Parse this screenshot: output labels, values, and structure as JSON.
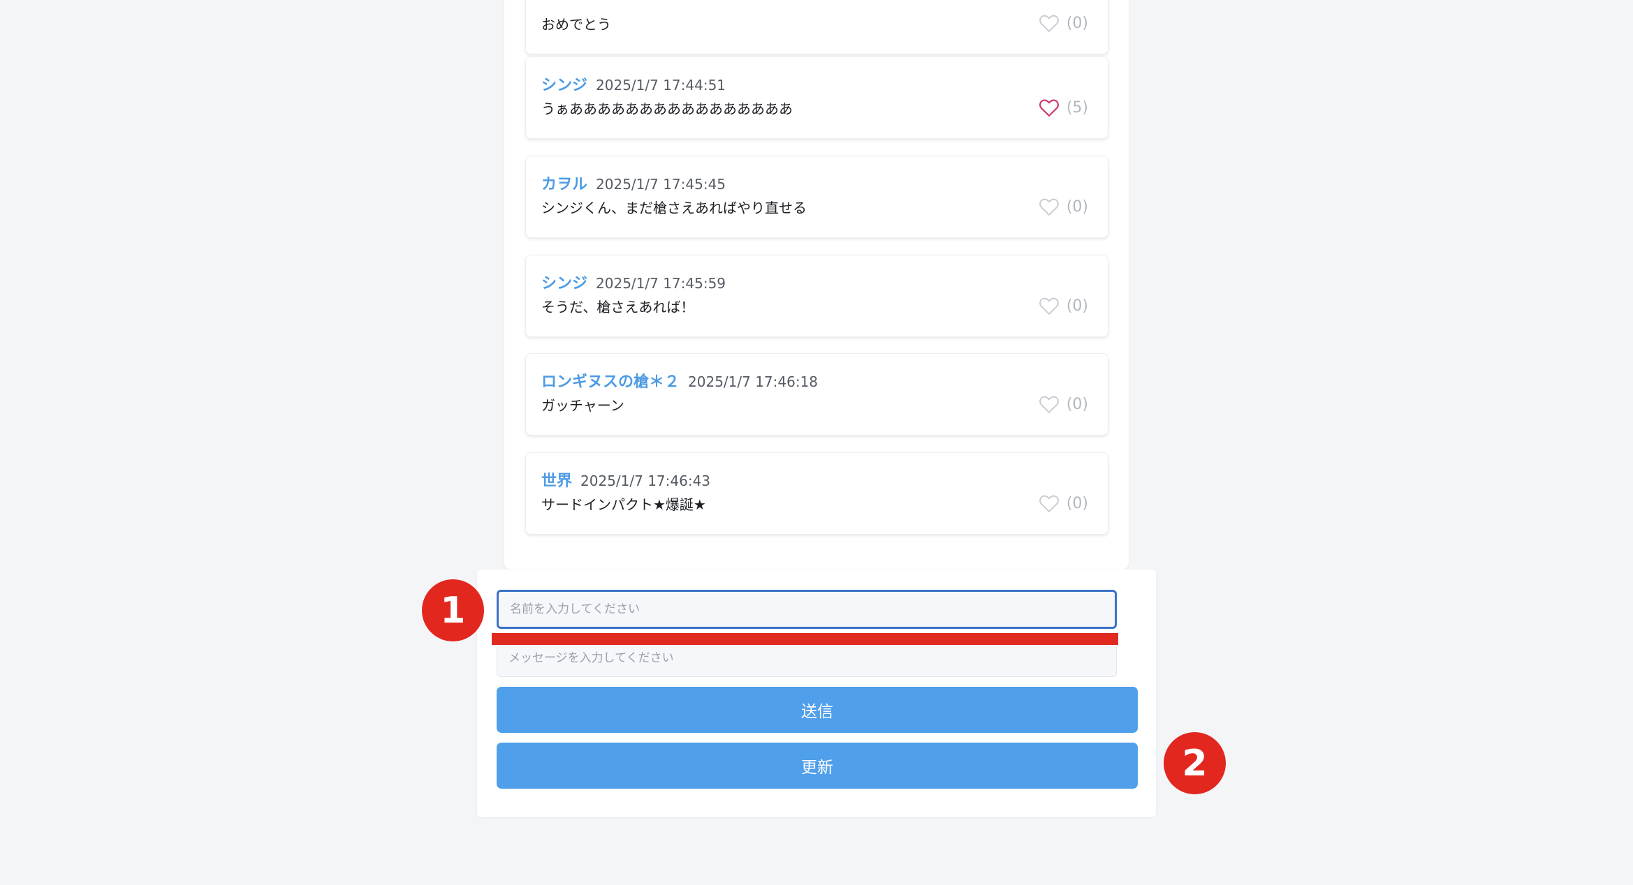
{
  "messages": [
    {
      "author": "",
      "time": "",
      "text": "おめでとう",
      "likes": "(0)",
      "liked": false
    },
    {
      "author": "シンジ",
      "time": "2025/1/7 17:44:51",
      "text": "うぁああああああああああああああああ",
      "likes": "(5)",
      "liked": true
    },
    {
      "author": "カヲル",
      "time": "2025/1/7 17:45:45",
      "text": "シンジくん、まだ槍さえあればやり直せる",
      "likes": "(0)",
      "liked": false
    },
    {
      "author": "シンジ",
      "time": "2025/1/7 17:45:59",
      "text": "そうだ、槍さえあれば！",
      "likes": "(0)",
      "liked": false
    },
    {
      "author": "ロンギヌスの槍＊２",
      "time": "2025/1/7 17:46:18",
      "text": "ガッチャーン",
      "likes": "(0)",
      "liked": false
    },
    {
      "author": "世界",
      "time": "2025/1/7 17:46:43",
      "text": "サードインパクト★爆誕★",
      "likes": "(0)",
      "liked": false
    }
  ],
  "form": {
    "name_placeholder": "名前を入力してください",
    "name_value": "",
    "message_placeholder": "メッセージを入力してください",
    "message_value": "",
    "send_label": "送信",
    "refresh_label": "更新"
  },
  "markers": {
    "first": "1",
    "second": "2"
  },
  "icons": {
    "like": "heart-icon"
  },
  "colors": {
    "author": "#4d9be4",
    "button": "#4f9fea",
    "heart_liked": "#c9336c",
    "heart_default": "#c6cacf",
    "annotation": "#e2271f",
    "input_focus_border": "#3a72c8"
  }
}
